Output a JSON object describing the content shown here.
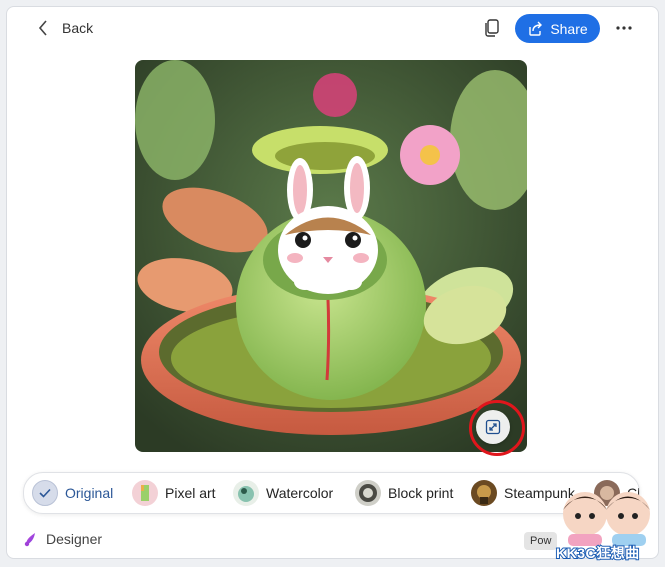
{
  "header": {
    "back_label": "Back",
    "share_label": "Share",
    "icons": {
      "back": "chevron-left-icon",
      "copy": "copy-icon",
      "share": "share-icon",
      "more": "more-horizontal-icon"
    }
  },
  "image": {
    "description_icon": "generated-image",
    "expand_icon": "expand-icon"
  },
  "styles": [
    {
      "label": "Original",
      "selected": true
    },
    {
      "label": "Pixel art",
      "selected": false
    },
    {
      "label": "Watercolor",
      "selected": false
    },
    {
      "label": "Block print",
      "selected": false
    },
    {
      "label": "Steampunk",
      "selected": false
    },
    {
      "label": "Cla",
      "selected": false
    }
  ],
  "footer": {
    "designer_label": "Designer",
    "powered_label": "Pow"
  },
  "watermark": {
    "text": "KK3C狂想曲"
  },
  "colors": {
    "accent": "#1f6fe5",
    "highlight": "#e0161c",
    "selected_text": "#2b5797"
  }
}
